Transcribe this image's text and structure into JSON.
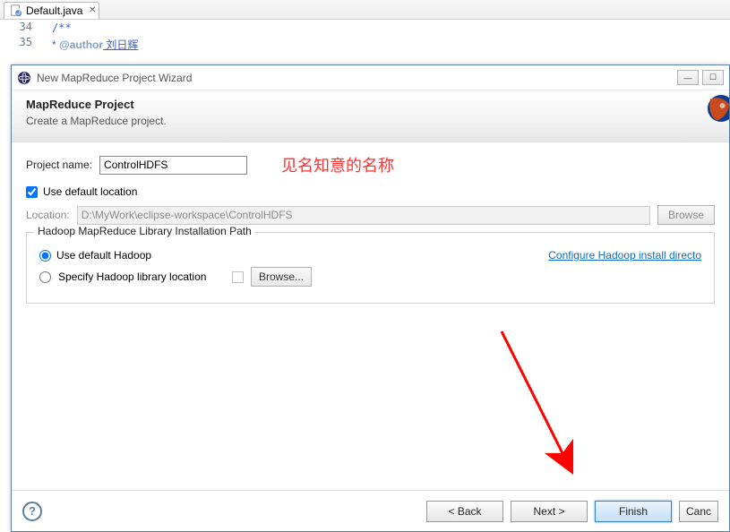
{
  "editor": {
    "tab_title": "Default.java",
    "line_numbers": [
      "34",
      "35"
    ],
    "line34": "/**",
    "line35_star": " * ",
    "line35_tag": "@author",
    "line35_name": " 刘日辉"
  },
  "dialog": {
    "title": "New MapReduce Project Wizard",
    "banner_title": "MapReduce Project",
    "banner_desc": "Create a MapReduce project.",
    "project_name_label": "Project name:",
    "project_name_value": "ControlHDFS",
    "annotation": "见名知意的名称",
    "use_default_location": "Use default location",
    "location_label": "Location:",
    "location_value": "D:\\MyWork\\eclipse-workspace\\ControlHDFS",
    "browse_label": "Browse",
    "group_title": "Hadoop MapReduce Library Installation Path",
    "use_default_hadoop": "Use default Hadoop",
    "configure_link": "Configure Hadoop install directo",
    "specify_hadoop": "Specify Hadoop library location",
    "browse2_label": "Browse...",
    "buttons": {
      "back": "< Back",
      "next": "Next >",
      "finish": "Finish",
      "cancel": "Canc"
    }
  }
}
